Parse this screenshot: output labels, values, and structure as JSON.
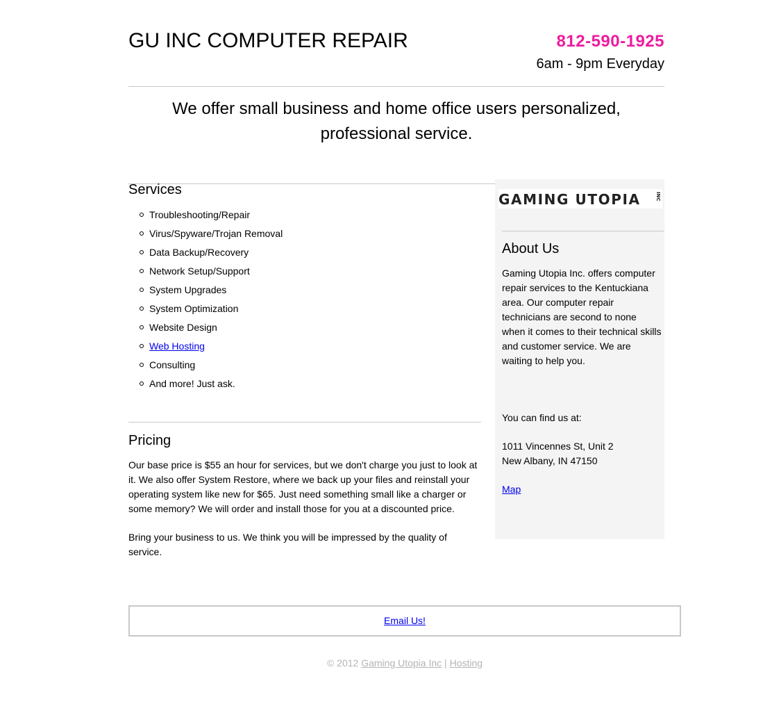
{
  "header": {
    "title": "GU INC COMPUTER REPAIR",
    "phone": "812-590-1925",
    "hours": "6am - 9pm Everyday"
  },
  "tagline": {
    "line1": "We offer small business and home office users personalized,",
    "line2": "professional service."
  },
  "services": {
    "heading": "Services",
    "items": [
      {
        "label": "Troubleshooting/Repair",
        "link": false
      },
      {
        "label": "Virus/Spyware/Trojan Removal",
        "link": false
      },
      {
        "label": "Data Backup/Recovery",
        "link": false
      },
      {
        "label": "Network Setup/Support",
        "link": false
      },
      {
        "label": "System Upgrades",
        "link": false
      },
      {
        "label": "System Optimization",
        "link": false
      },
      {
        "label": "Website Design",
        "link": false
      },
      {
        "label": "Web Hosting",
        "link": true
      },
      {
        "label": "Consulting",
        "link": false
      },
      {
        "label": "And more! Just ask.",
        "link": false
      }
    ]
  },
  "pricing": {
    "heading": "Pricing",
    "paragraph1": "Our base price is $55 an hour for services, but we don't charge you just to look at it.  We also offer System Restore, where we back up your files and reinstall your operating system like new for $65. Just need something small like a charger or some memory? We will order and install those for you at a discounted price.",
    "paragraph2": "Bring your business to us. We think you will be impressed by the quality of service."
  },
  "sidebar": {
    "logo_text": "GAMING UTOPIA",
    "logo_suffix": "INC",
    "about_heading": "About Us",
    "about_text": "Gaming Utopia Inc. offers computer repair services to the Kentuckiana area. Our computer repair technicians are second to none when it comes to their technical skills and customer service. We are waiting to help you.",
    "find_us": "You can find us at:",
    "address_line1": "1011 Vincennes St, Unit 2",
    "address_line2": "New Albany, IN 47150",
    "map_link": "Map"
  },
  "contact": {
    "email_link": "Email Us!"
  },
  "footer": {
    "copyright": "© 2012",
    "company_link": "Gaming Utopia Inc",
    "separator": "|",
    "hosting_link": "Hosting"
  },
  "colors": {
    "phone": "#ee1ba0",
    "link": "#0000ee",
    "footer_text": "#b4b4b4",
    "sidebar_bg": "#f4f4f4",
    "divider": "#c8c8c8"
  }
}
